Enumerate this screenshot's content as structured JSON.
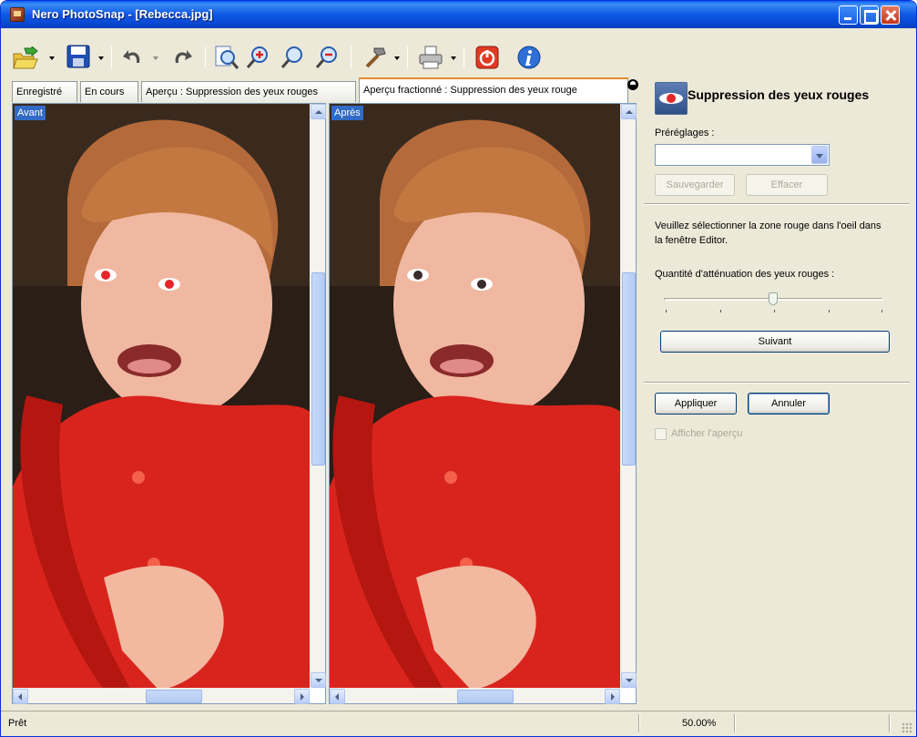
{
  "window": {
    "title": "Nero PhotoSnap - [Rebecca.jpg]"
  },
  "toolbar": {
    "items": [
      {
        "name": "open-icon"
      },
      {
        "name": "save-icon"
      },
      {
        "name": "undo-icon"
      },
      {
        "name": "redo-icon"
      },
      {
        "name": "zoom-fit-icon"
      },
      {
        "name": "zoom-in-icon"
      },
      {
        "name": "zoom-actual-icon"
      },
      {
        "name": "zoom-out-icon"
      },
      {
        "name": "tools-icon"
      },
      {
        "name": "print-icon"
      },
      {
        "name": "exit-icon"
      },
      {
        "name": "info-icon"
      }
    ]
  },
  "tabs": [
    {
      "label": "Enregistré",
      "active": false
    },
    {
      "label": "En cours",
      "active": false
    },
    {
      "label": "Aperçu : Suppression des yeux rouges",
      "active": false
    },
    {
      "label": "Aperçu fractionné : Suppression des yeux rouge",
      "active": true
    }
  ],
  "panes": {
    "left_label": "Avant",
    "right_label": "Après"
  },
  "panel": {
    "title": "Suppression des yeux rouges",
    "presets_label": "Préréglages :",
    "presets_value": "",
    "save_button": "Sauvegarder",
    "delete_button": "Effacer",
    "instruction": "Veuillez sélectionner la zone rouge dans l'oeil dans la fenêtre Editor.",
    "amount_label": "Quantité d'atténuation des yeux rouges :",
    "amount_value": 0.5,
    "next_button": "Suivant",
    "apply_button": "Appliquer",
    "cancel_button": "Annuler",
    "preview_checkbox": "Afficher l'aperçu",
    "preview_checked": false
  },
  "status": {
    "left": "Prêt",
    "zoom": "50.00%"
  },
  "colors": {
    "titlebar": "#0a4fd6",
    "tab_accent": "#e68b2c",
    "selection": "#316ac5",
    "shirt": "#d8241c"
  }
}
